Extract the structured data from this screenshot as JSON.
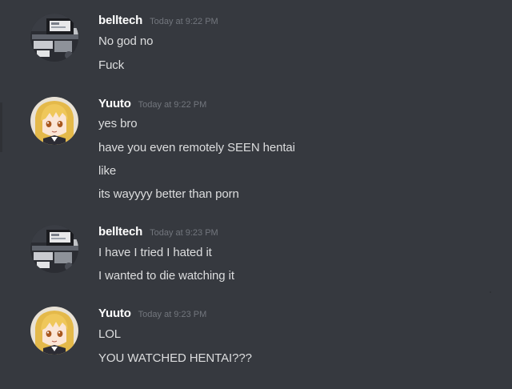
{
  "messages": [
    {
      "author": "belltech",
      "timestamp": "Today at 9:22 PM",
      "avatar_icon": "desk-photo-avatar-icon",
      "lines": [
        "No god no",
        "Fuck"
      ]
    },
    {
      "author": "Yuuto",
      "timestamp": "Today at 9:22 PM",
      "avatar_icon": "anime-girl-avatar-icon",
      "lines": [
        "yes bro",
        "have you even remotely SEEN hentai",
        "like",
        "its wayyyy better than porn"
      ]
    },
    {
      "author": "belltech",
      "timestamp": "Today at 9:23 PM",
      "avatar_icon": "desk-photo-avatar-icon",
      "lines": [
        "I have I tried I hated it",
        "I wanted to die watching it"
      ]
    },
    {
      "author": "Yuuto",
      "timestamp": "Today at 9:23 PM",
      "avatar_icon": "anime-girl-avatar-icon",
      "lines": [
        "LOL",
        "YOU WATCHED HENTAI???"
      ]
    }
  ],
  "colors": {
    "background": "#36393f",
    "username": "#ffffff",
    "timestamp": "#72767d",
    "message_text": "#dcddde"
  }
}
